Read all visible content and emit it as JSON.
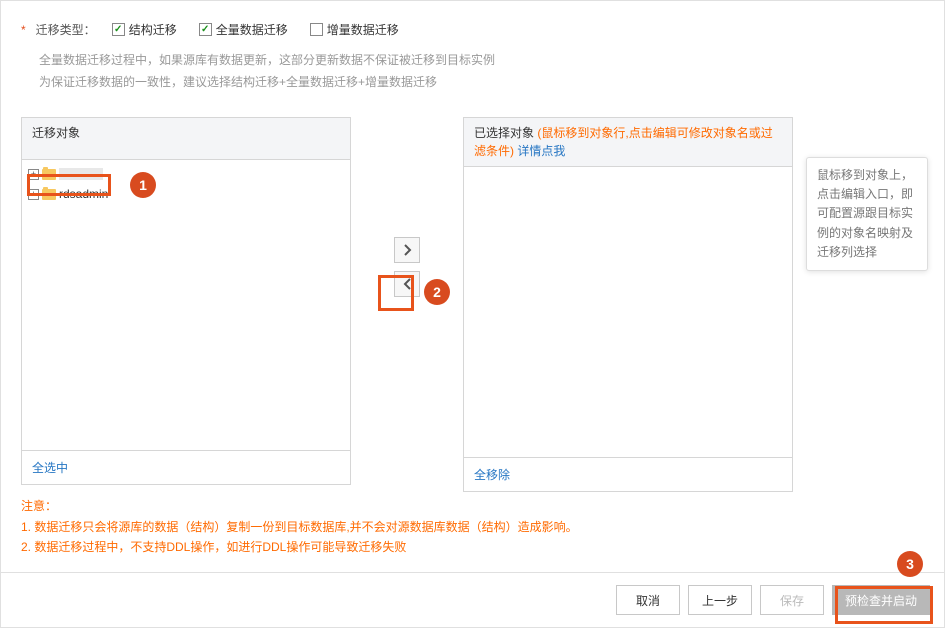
{
  "migrationType": {
    "label": "迁移类型：",
    "options": [
      {
        "label": "结构迁移",
        "checked": true
      },
      {
        "label": "全量数据迁移",
        "checked": true
      },
      {
        "label": "增量数据迁移",
        "checked": false
      }
    ]
  },
  "description": {
    "line1": "全量数据迁移过程中，如果源库有数据更新，这部分更新数据不保证被迁移到目标实例",
    "line2": "为保证迁移数据的一致性，建议选择结构迁移+全量数据迁移+增量数据迁移"
  },
  "sourceList": {
    "title": "迁移对象",
    "items": [
      {
        "label": "",
        "masked": true
      },
      {
        "label": "rdsadmin",
        "masked": false
      }
    ],
    "footerLink": "全选中"
  },
  "targetList": {
    "titlePrefix": "已选择对象",
    "titleHint": "(鼠标移到对象行,点击编辑可修改对象名或过滤条件)",
    "titleLink": "详情点我",
    "footerLink": "全移除"
  },
  "tooltip": "鼠标移到对象上，点击编辑入口，即可配置源跟目标实例的对象名映射及迁移列选择",
  "notice": {
    "title": "注意：",
    "line1": "1. 数据迁移只会将源库的数据（结构）复制一份到目标数据库,并不会对源数据库数据（结构）造成影响。",
    "line2": "2. 数据迁移过程中，不支持DDL操作，如进行DDL操作可能导致迁移失败"
  },
  "buttons": {
    "cancel": "取消",
    "prev": "上一步",
    "save": "保存",
    "start": "预检查并启动"
  },
  "callouts": {
    "c1": "1",
    "c2": "2",
    "c3": "3"
  }
}
